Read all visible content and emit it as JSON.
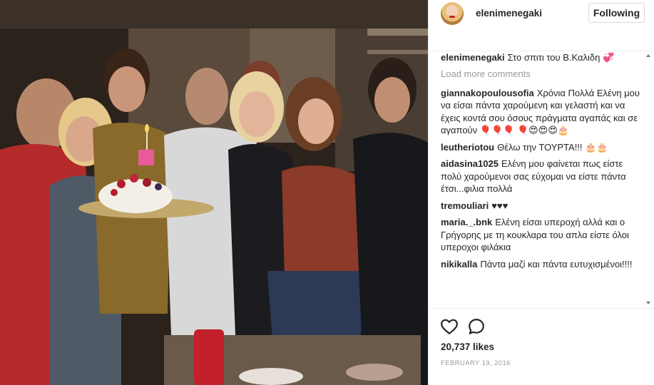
{
  "post": {
    "photo_alt": "",
    "author": "elenimenegaki",
    "follow_label": "Following",
    "caption": {
      "user": "elenimenegaki",
      "text": "Στο σπιτι του Β.Καλιδη 💞"
    },
    "load_more_label": "Load more comments",
    "comments": [
      {
        "user": "giannakopoulousofia",
        "text": "Χρόνια Πολλά Ελένη μου να είσαι πάντα χαρούμενη και γελαστή και να έχεις κοντά σου όσους πράγματα αγαπάς και σε αγαπούν 🎈🎈🎈 🎈😍😍😍🎂"
      },
      {
        "user": "leutheriotou",
        "text": "Θέλω την ΤΟΥΡΤΑ!!! 🎂🎂"
      },
      {
        "user": "aidasina1025",
        "text": "Ελένη μου φαίνεται πως είστε πολύ χαρούμενοι σας εύχομαι να είστε πάντα έτσι...φιλια πολλά"
      },
      {
        "user": "tremouliari",
        "text": "♥♥♥"
      },
      {
        "user": "maria._.bnk",
        "text": "Ελένη είσαι υπεροχή αλλά και ο Γρήγορης με τη κουκλαρα του απλα είστε όλοι υπεροχοι φιλάκια"
      },
      {
        "user": "nikikalla",
        "text": "Πάντα μαζί και πάντα ευτυχισμένοι!!!!"
      }
    ],
    "likes": "20,737 likes",
    "date": "FEBRUARY 19, 2016"
  },
  "icons": {
    "heart": "heart-outline-icon",
    "comment": "speech-bubble-icon",
    "avatar": "profile-avatar",
    "scroll_up": "scroll-up-arrow-icon",
    "scroll_down": "scroll-down-arrow-icon"
  },
  "colors": {
    "text": "#262626",
    "muted": "#999999",
    "border": "#efefef",
    "button_border": "#dbdbdb"
  }
}
